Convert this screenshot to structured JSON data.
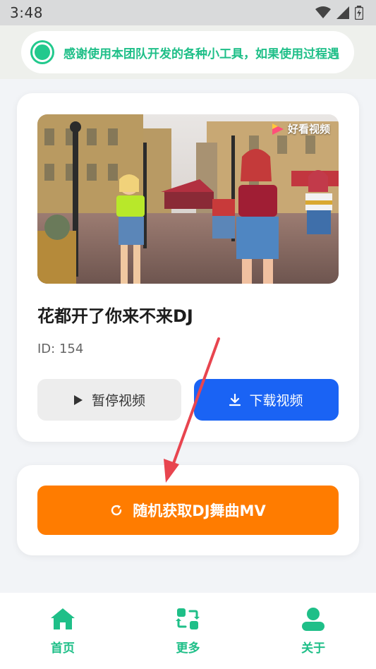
{
  "status_bar": {
    "time": "3:48",
    "icons": [
      "wifi-icon",
      "cellular-signal-icon",
      "battery-icon"
    ]
  },
  "notice": {
    "text": "感谢使用本团队开发的各种小工具，如果使用过程遇",
    "icon": "status-dot-icon"
  },
  "video": {
    "watermark": "好看视频",
    "title": "花都开了你来不来DJ",
    "id_label": "ID: 154",
    "pause_label": "暂停视频",
    "download_label": "下载视频"
  },
  "random": {
    "label": "随机获取DJ舞曲MV"
  },
  "nav": {
    "items": [
      {
        "label": "首页",
        "icon": "home-icon"
      },
      {
        "label": "更多",
        "icon": "more-icon"
      },
      {
        "label": "关于",
        "icon": "user-icon"
      }
    ]
  },
  "colors": {
    "accent_green": "#1fbf88",
    "download_blue": "#1a63f4",
    "random_orange": "#ff7c00",
    "arrow_red": "#e8454f"
  }
}
